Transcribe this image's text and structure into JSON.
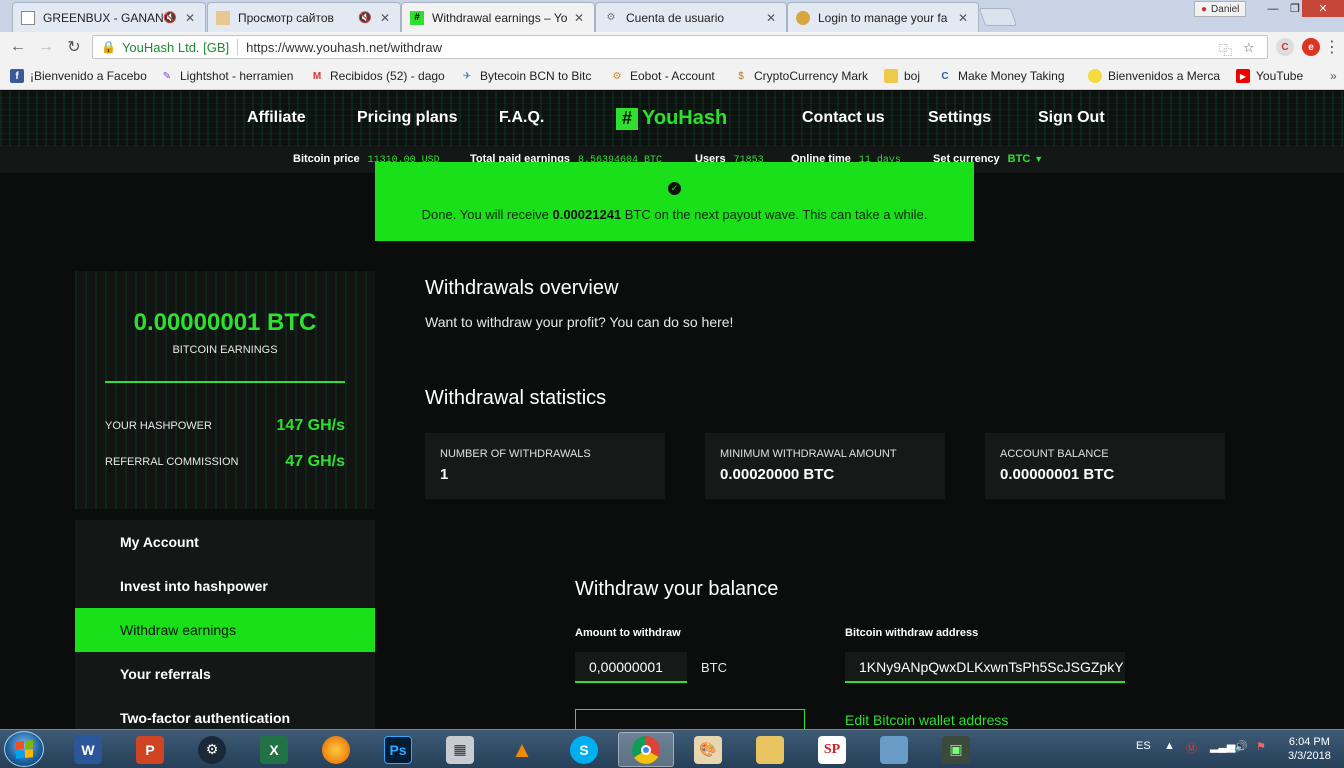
{
  "browser": {
    "tabs": [
      {
        "label": "GREENBUX - GANANC",
        "muted": true
      },
      {
        "label": "Просмотр сайтов",
        "muted": true
      },
      {
        "label": "Withdrawal earnings – Yo",
        "muted": false
      },
      {
        "label": "Cuenta de usuario",
        "muted": false
      },
      {
        "label": "Login to manage your fa",
        "muted": false
      }
    ],
    "profile_name": "Daniel",
    "secure_label": "YouHash Ltd. [GB]",
    "url": "https://www.youhash.net/withdraw",
    "bookmarks": [
      {
        "label": "¡Bienvenido a Facebo",
        "icon": "facebook-icon"
      },
      {
        "label": "Lightshot - herramien",
        "icon": "lightshot-icon"
      },
      {
        "label": "Recibidos (52) - dago",
        "icon": "gmail-icon"
      },
      {
        "label": "Bytecoin BCN to Bitc",
        "icon": "plane-icon"
      },
      {
        "label": "Eobot - Account",
        "icon": "eobot-icon"
      },
      {
        "label": "CryptoCurrency Mark",
        "icon": "coin-icon"
      },
      {
        "label": "boj",
        "icon": "folder-icon"
      },
      {
        "label": "Make Money Taking",
        "icon": "swirl-icon"
      },
      {
        "label": "Bienvenidos a Merca",
        "icon": "handshake-icon"
      },
      {
        "label": "YouTube",
        "icon": "youtube-icon"
      }
    ],
    "bookmarks_overflow": "»"
  },
  "site": {
    "nav": {
      "affiliate": "Affiliate",
      "pricing": "Pricing plans",
      "faq": "F.A.Q.",
      "logo_hash": "#",
      "logo_name": "YouHash",
      "contact": "Contact us",
      "settings": "Settings",
      "signout": "Sign Out"
    },
    "stats": {
      "bitcoin_price_label": "Bitcoin price",
      "bitcoin_price_value": "11310.00 USD",
      "total_paid_label": "Total paid earnings",
      "total_paid_value": "8.56394604 BTC",
      "users_label": "Users",
      "users_value": "71853",
      "online_label": "Online time",
      "online_value": "11 days",
      "currency_label": "Set currency",
      "currency_value": "BTC"
    },
    "alert": {
      "prefix": "Done. You will receive ",
      "amount": "0.00021241",
      "suffix": " BTC on the next payout wave. This can take a while."
    },
    "earnings": {
      "amount": "0.00000001 BTC",
      "label": "BITCOIN EARNINGS",
      "hashpower_label": "YOUR HASHPOWER",
      "hashpower_value": "147 GH/s",
      "referral_label": "REFERRAL COMMISSION",
      "referral_value": "47 GH/s"
    },
    "menu": [
      {
        "label": "My Account",
        "active": false
      },
      {
        "label": "Invest into hashpower",
        "active": false
      },
      {
        "label": "Withdraw earnings",
        "active": true
      },
      {
        "label": "Your referrals",
        "active": false
      },
      {
        "label": "Two-factor authentication",
        "active": false
      }
    ],
    "overview": {
      "title": "Withdrawals overview",
      "text": "Want to withdraw your profit? You can do so here!"
    },
    "statistics": {
      "title": "Withdrawal statistics",
      "cards": [
        {
          "label": "NUMBER OF WITHDRAWALS",
          "value": "1"
        },
        {
          "label": "MINIMUM WITHDRAWAL AMOUNT",
          "value": "0.00020000 BTC"
        },
        {
          "label": "ACCOUNT BALANCE",
          "value": "0.00000001 BTC"
        }
      ]
    },
    "withdraw_form": {
      "title": "Withdraw your balance",
      "amount_label": "Amount to withdraw",
      "amount_value": "0,00000001",
      "amount_unit": "BTC",
      "address_label": "Bitcoin withdraw address",
      "address_value": "1KNy9ANpQwxDLKxwnTsPh5ScJSGZpkY",
      "edit_link": "Edit Bitcoin wallet address"
    }
  },
  "taskbar": {
    "apps": [
      "word-icon",
      "powerpoint-icon",
      "steam-icon",
      "excel-icon",
      "firefox-icon",
      "photoshop-icon",
      "calculator-icon",
      "vlc-icon",
      "skype-icon",
      "chrome-icon",
      "paint-icon",
      "explorer-icon",
      "sp-icon",
      "photo-viewer-icon",
      "monitor-icon"
    ],
    "language": "ES",
    "time": "6:04 PM",
    "date": "3/3/2018"
  }
}
